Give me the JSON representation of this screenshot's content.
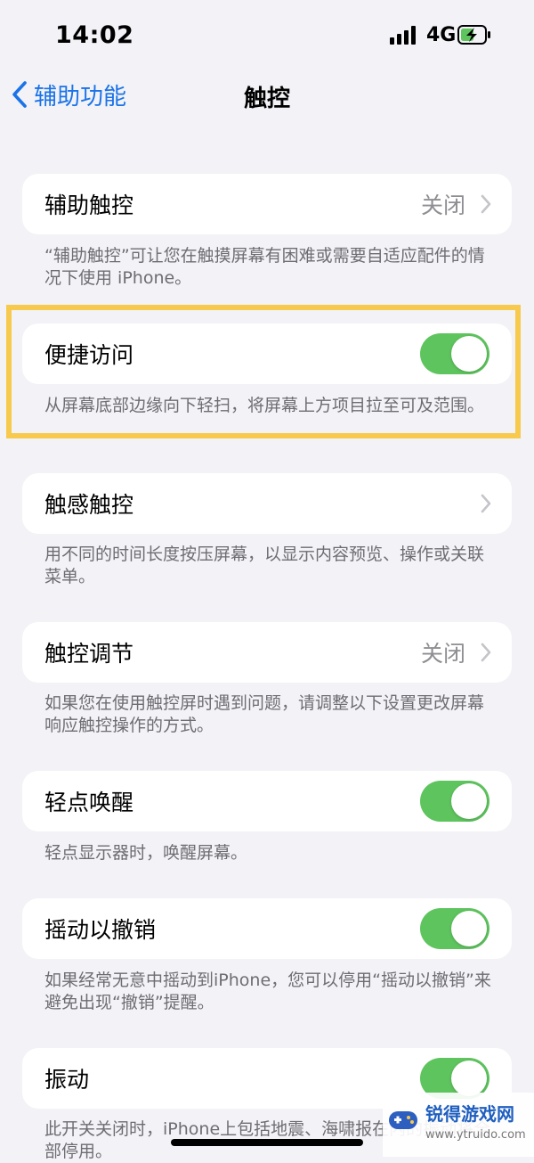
{
  "status": {
    "time": "14:02",
    "network": "4G"
  },
  "nav": {
    "back_label": "辅助功能",
    "title": "触控"
  },
  "rows": [
    {
      "label": "辅助触控",
      "value": "关闭",
      "footer": "“辅助触控”可让您在触摸屏幕有困难或需要自适应配件的情况下使用 iPhone。"
    },
    {
      "label": "便捷访问",
      "toggle_on": true,
      "footer": "从屏幕底部边缘向下轻扫，将屏幕上方项目拉至可及范围。"
    },
    {
      "label": "触感触控",
      "footer": "用不同的时间长度按压屏幕，以显示内容预览、操作或关联菜单。"
    },
    {
      "label": "触控调节",
      "value": "关闭",
      "footer": "如果您在使用触控屏时遇到问题，请调整以下设置更改屏幕响应触控操作的方式。"
    },
    {
      "label": "轻点唤醒",
      "toggle_on": true,
      "footer": "轻点显示器时，唤醒屏幕。"
    },
    {
      "label": "摇动以撤销",
      "toggle_on": true,
      "footer": "如果经常无意中摇动到iPhone，您可以停用“摇动以撤销”来避免出现“撤销”提醒。"
    },
    {
      "label": "振动",
      "toggle_on": true,
      "footer": "此开关关闭时，iPhone上包括地震、海啸报在内的振动将全部停用。"
    }
  ],
  "watermark": {
    "name": "锐得游戏网",
    "url": "www.ytruido.com"
  },
  "colors": {
    "accent": "#1a73e8",
    "toggle_on": "#5ec45e",
    "highlight": "#f7ca4d"
  }
}
